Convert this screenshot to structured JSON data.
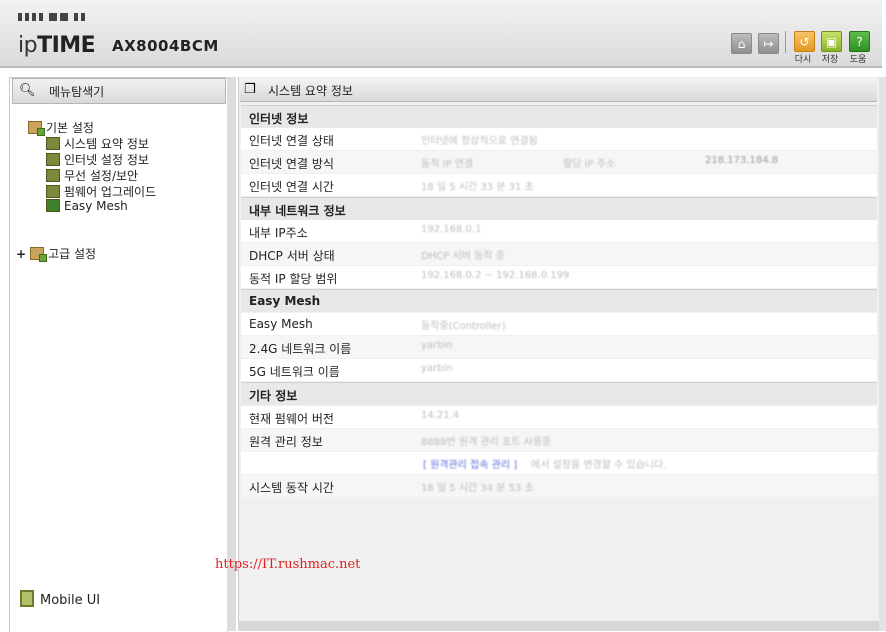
{
  "header": {
    "brand_prefix": "ip",
    "brand_bold": "TIME",
    "model": "AX8004BCM",
    "buttons": [
      {
        "name": "home",
        "icon": "home-icon"
      },
      {
        "name": "logout",
        "icon": "logout-icon"
      },
      {
        "name": "refresh",
        "icon": "refresh-icon",
        "label": "다시"
      },
      {
        "name": "save",
        "icon": "save-icon",
        "label": "저장"
      },
      {
        "name": "help",
        "icon": "help-icon",
        "label": "도움"
      }
    ]
  },
  "sidebar": {
    "title": "메뉴탐색기",
    "groups": [
      {
        "label": "기본 설정",
        "expanded": true,
        "items": [
          "시스템 요약 정보",
          "인터넷 설정 정보",
          "무선 설정/보안",
          "펌웨어 업그레이드",
          "Easy Mesh"
        ]
      },
      {
        "label": "고급 설정",
        "expanded": false,
        "toggle": "+"
      }
    ],
    "mobile_ui": "Mobile UI"
  },
  "main": {
    "title": "시스템 요약 정보",
    "sections": [
      {
        "title": "인터넷 정보",
        "rows": [
          {
            "label": "인터넷 연결 상태",
            "values": [
              "인터넷에 정상적으로 연결됨"
            ]
          },
          {
            "label": "인터넷 연결 방식",
            "values": [
              "동적 IP 연결",
              "할당 IP 주소",
              "218.173.184.8"
            ]
          },
          {
            "label": "인터넷 연결 시간",
            "values": [
              "18 일 5 시간 33 분 31 초"
            ]
          }
        ]
      },
      {
        "title": "내부 네트워크 정보",
        "rows": [
          {
            "label": "내부 IP주소",
            "values": [
              "192.168.0.1"
            ]
          },
          {
            "label": "DHCP 서버 상태",
            "values": [
              "DHCP 서버 동작 중"
            ]
          },
          {
            "label": "동적 IP 할당 범위",
            "values": [
              "192.168.0.2 ~ 192.168.0.199"
            ]
          }
        ]
      },
      {
        "title": "Easy Mesh",
        "rows": [
          {
            "label": "Easy Mesh",
            "values": [
              "동작중(Controller)"
            ]
          },
          {
            "label": "2.4G 네트워크 이름",
            "values": [
              "yarbin"
            ]
          },
          {
            "label": "5G 네트워크 이름",
            "values": [
              "yarbin"
            ]
          }
        ]
      },
      {
        "title": "기타 정보",
        "rows": [
          {
            "label": "현재 펌웨어 버전",
            "values": [
              "14.21.4"
            ]
          },
          {
            "label": "원격 관리 정보",
            "values": [
              "8888번 원격 관리 포트 사용중"
            ]
          },
          {
            "label": "",
            "values": [
              "[ 원격관리 접속 관리 ]",
              "에서 설정을 변경할 수 있습니다."
            ]
          },
          {
            "label": "시스템 동작 시간",
            "values": [
              "18 일 5 시간 34 분 53 초"
            ]
          }
        ]
      }
    ]
  },
  "watermark": "https://IT.rushmac.net"
}
